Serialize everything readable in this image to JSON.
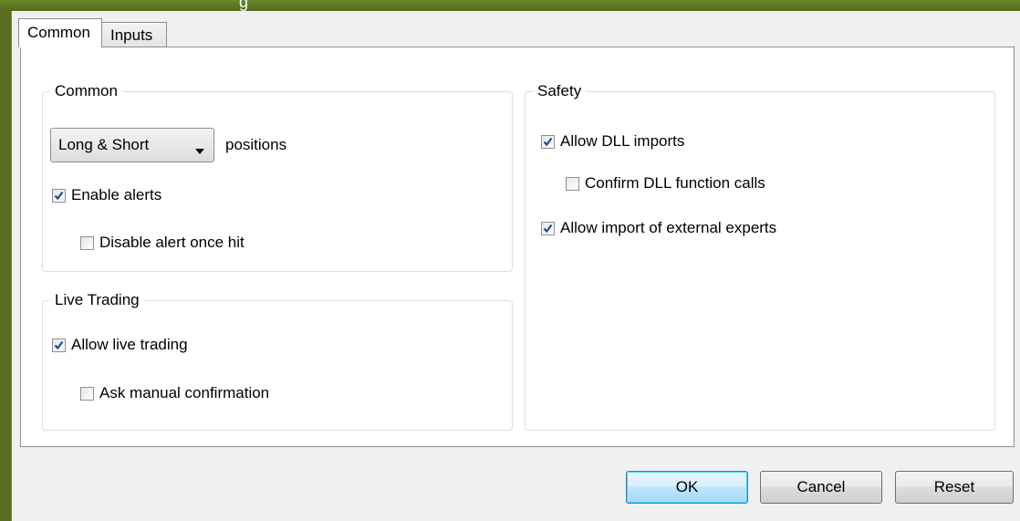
{
  "window": {
    "title_fragment": "g"
  },
  "tabs": [
    {
      "label": "Common",
      "active": true
    },
    {
      "label": "Inputs",
      "active": false
    }
  ],
  "common_group": {
    "legend": "Common",
    "positions_select": {
      "value": "Long & Short",
      "suffix": "positions"
    },
    "enable_alerts": {
      "label": "Enable alerts",
      "checked": true
    },
    "disable_alert_once_hit": {
      "label": "Disable alert once hit",
      "checked": false
    }
  },
  "live_trading_group": {
    "legend": "Live Trading",
    "allow_live_trading": {
      "label": "Allow live trading",
      "checked": true
    },
    "ask_manual_confirmation": {
      "label": "Ask manual confirmation",
      "checked": false
    }
  },
  "safety_group": {
    "legend": "Safety",
    "allow_dll_imports": {
      "label": "Allow DLL imports",
      "checked": true
    },
    "confirm_dll_function_calls": {
      "label": "Confirm DLL function calls",
      "checked": false
    },
    "allow_import_external_experts": {
      "label": "Allow import of external experts",
      "checked": true
    }
  },
  "buttons": {
    "ok": "OK",
    "cancel": "Cancel",
    "reset": "Reset"
  },
  "colors": {
    "desktop": "#5a6e22",
    "default_button_border": "#3c7fb1",
    "check": "#1b4d9a"
  }
}
